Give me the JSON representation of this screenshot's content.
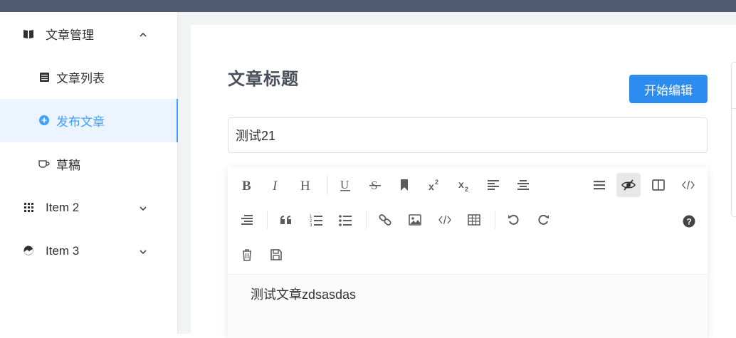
{
  "sidebar": {
    "items": [
      {
        "label": "文章管理",
        "icon": "book-icon",
        "arrow": "chevron-up-icon"
      },
      {
        "label": "文章列表",
        "icon": "list-icon"
      },
      {
        "label": "发布文章",
        "icon": "plus-circle-icon"
      },
      {
        "label": "草稿",
        "icon": "cup-icon"
      },
      {
        "label": "Item 2",
        "icon": "grid-icon",
        "arrow": "chevron-down-icon"
      },
      {
        "label": "Item 3",
        "icon": "picture-icon",
        "arrow": "chevron-down-icon"
      }
    ]
  },
  "main": {
    "title": "文章标题",
    "start_edit_label": "开始编辑",
    "title_input_value": "测试21",
    "editor_content": "测试文章zdsasdas"
  },
  "toolbar": {
    "row1": [
      "bold",
      "italic",
      "header",
      "underline",
      "strikethrough",
      "mark",
      "superscript",
      "subscript",
      "align-left",
      "align-center",
      "navigation",
      "preview",
      "subfield",
      "html-code"
    ],
    "row2": [
      "align-right",
      "quote",
      "ordered-list",
      "unordered-list",
      "link",
      "image",
      "code",
      "table",
      "undo",
      "redo",
      "help"
    ],
    "row3": [
      "trash",
      "save"
    ]
  },
  "colors": {
    "topbar": "#505a70",
    "primary": "#2d8cf0",
    "active_menu": "#409eff",
    "active_menu_bg": "#ecf5ff"
  }
}
